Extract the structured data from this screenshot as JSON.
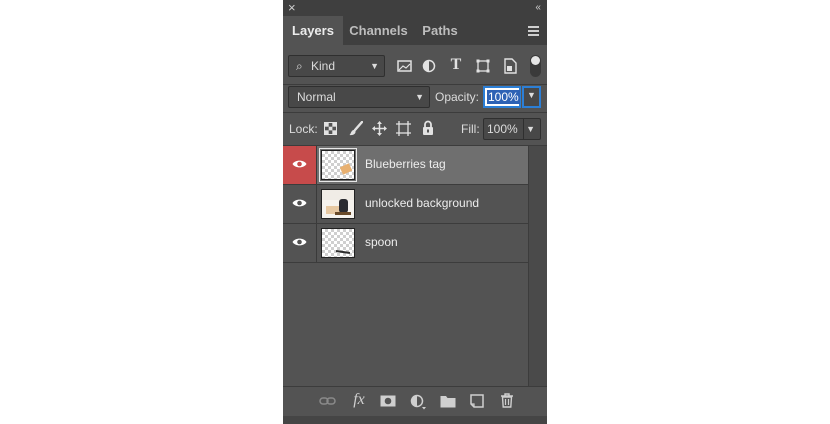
{
  "window": {
    "close_icon": "×",
    "collapse_icon": "‹‹"
  },
  "tabs": [
    {
      "label": "Layers",
      "active": true
    },
    {
      "label": "Channels",
      "active": false
    },
    {
      "label": "Paths",
      "active": false
    }
  ],
  "filter": {
    "kind_label": "Kind",
    "icons": [
      "image-filter-icon",
      "adjustment-filter-icon",
      "type-filter-icon",
      "shape-filter-icon",
      "smart-object-filter-icon"
    ],
    "type_glyph": "T"
  },
  "blend": {
    "mode": "Normal",
    "opacity_label": "Opacity:",
    "opacity_value": "100%"
  },
  "lock": {
    "label": "Lock:",
    "fill_label": "Fill:",
    "fill_value": "100%"
  },
  "layers": [
    {
      "name": "Blueberries tag",
      "visible": true,
      "selected": true
    },
    {
      "name": "unlocked background",
      "visible": true,
      "selected": false
    },
    {
      "name": "spoon",
      "visible": true,
      "selected": false
    }
  ],
  "footer": {
    "icons": [
      "link-layers-icon",
      "fx-icon",
      "add-mask-icon",
      "adjustment-layer-icon",
      "new-group-icon",
      "new-layer-icon",
      "delete-layer-icon"
    ],
    "fx_label": "fx"
  },
  "colors": {
    "panel_bg": "#535353",
    "selected_row": "#6f6f6f",
    "selected_eye_cell": "#c74b4b",
    "focus_border": "#2c7fd6"
  }
}
